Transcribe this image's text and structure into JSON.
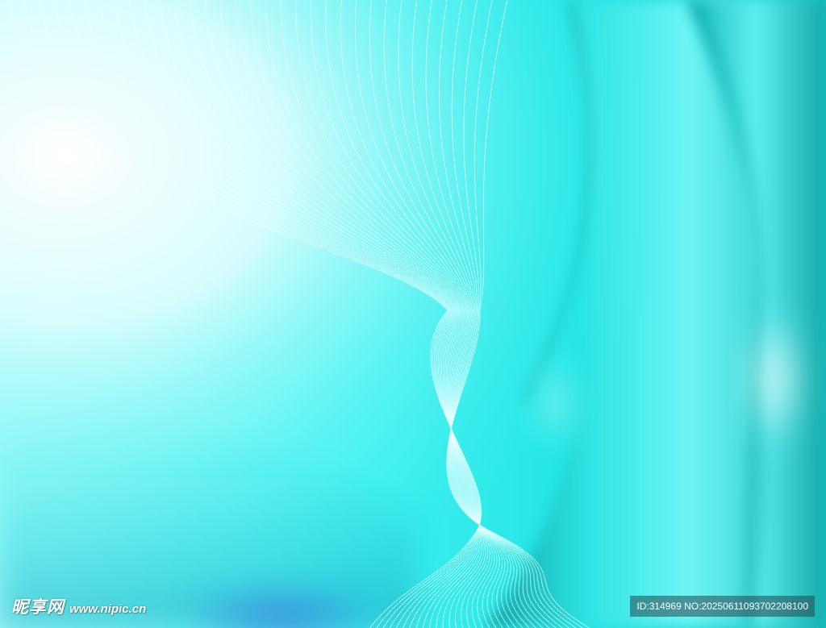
{
  "image": {
    "subject": "abstract-cyan-silk-waves",
    "colors": {
      "highlight": "#ffffff",
      "light_cyan": "#b8fbfb",
      "cyan": "#34f2f2",
      "deep_teal": "#14b5b5",
      "shadow_teal": "#0f9a9a",
      "blue_accent": "#3a7fe0",
      "line_color": "#e6ffff"
    }
  },
  "watermark": {
    "brand": "昵享网",
    "url": "www.nipic.cn"
  },
  "id_label": {
    "text": "ID:314969 NO:20250611093702208100"
  }
}
